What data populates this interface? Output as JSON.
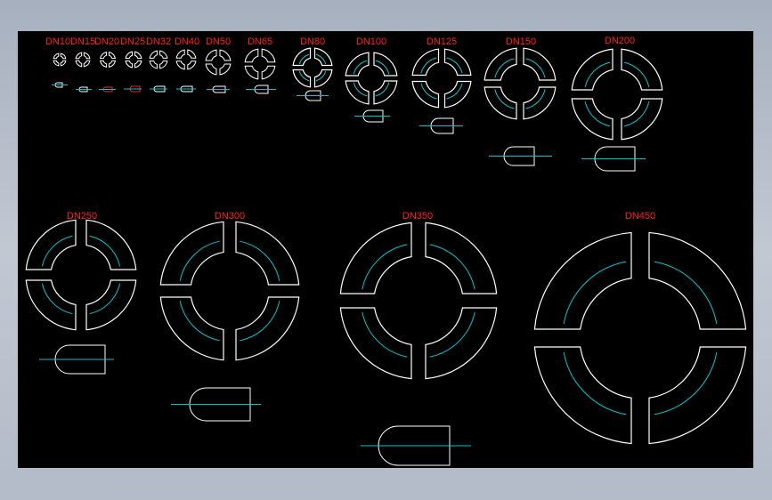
{
  "colors": {
    "background": "#000000",
    "outline": "#ffffff",
    "centerline": "#00c8d2",
    "label": "#ff2020",
    "accent_small": "#ff2020"
  },
  "flanges": [
    {
      "label": "DN10"
    },
    {
      "label": "DN15"
    },
    {
      "label": "DN20"
    },
    {
      "label": "DN25"
    },
    {
      "label": "DN32"
    },
    {
      "label": "DN40"
    },
    {
      "label": "DN50"
    },
    {
      "label": "DN65"
    },
    {
      "label": "DN80"
    },
    {
      "label": "DN100"
    },
    {
      "label": "DN125"
    },
    {
      "label": "DN150"
    },
    {
      "label": "DN200"
    },
    {
      "label": "DN250"
    },
    {
      "label": "DN300"
    },
    {
      "label": "DN350"
    },
    {
      "label": "DN450"
    }
  ]
}
